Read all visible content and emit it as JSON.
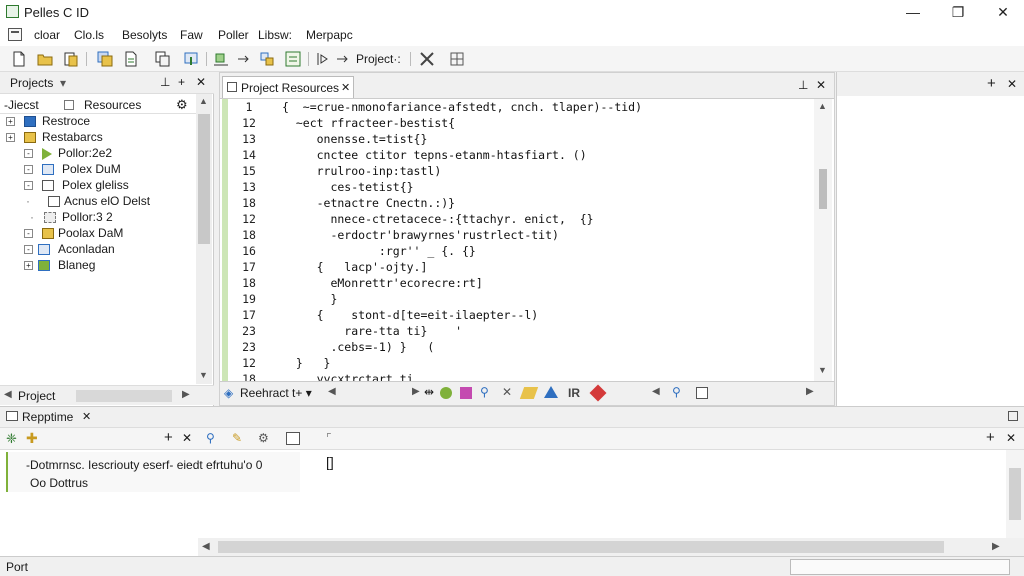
{
  "window": {
    "title": "Pelles C ID",
    "minimize": "—",
    "maximize": "❐",
    "close": "✕"
  },
  "menu": [
    "cloar",
    "Clo.ls",
    "Besolyts",
    "Faw",
    "Poller",
    "Libsw:",
    "Merpapc"
  ],
  "toolbar": {
    "project_label": "Project·:"
  },
  "projects_panel": {
    "title": "Projects",
    "dropdown": "▾",
    "pin": "⊥",
    "close": "✕",
    "subtabs": {
      "files": "-Jiecst",
      "resources": "Resources"
    },
    "tree": [
      {
        "label": "Restroce",
        "indent": 0,
        "expander": "+",
        "icon": "folder-blue"
      },
      {
        "label": "Restabarcs",
        "indent": 0,
        "expander": "+",
        "icon": "folder-yellow"
      },
      {
        "label": "Pollor:2e2",
        "indent": 1,
        "expander": "-",
        "icon": "play-green"
      },
      {
        "label": "Polex DuM",
        "indent": 1,
        "expander": "-",
        "icon": "file-blue"
      },
      {
        "label": "Polex gleliss",
        "indent": 1,
        "expander": "-",
        "icon": "file-white"
      },
      {
        "label": "Acnus elO Delst",
        "indent": 1,
        "expander": "·",
        "icon": "file-white"
      },
      {
        "label": "Pollor:3 2",
        "indent": 1,
        "expander": "·",
        "icon": "file-grey"
      },
      {
        "label": "Poolax DaM",
        "indent": 1,
        "expander": "-",
        "icon": "folder-yellow"
      },
      {
        "label": "Aconladan",
        "indent": 1,
        "expander": "-",
        "icon": "window-blue"
      },
      {
        "label": "Blaneg",
        "indent": 1,
        "expander": "+",
        "icon": "image-green"
      }
    ],
    "bottom_tab": "Project"
  },
  "editor": {
    "tab_label": "Project Resources",
    "tab_close": "✕",
    "pin": "⊥",
    "close": "✕",
    "line_numbers": [
      "1",
      "12",
      "13",
      "14",
      "15",
      "13",
      "18",
      "12",
      "18",
      "16",
      "17",
      "18",
      "19",
      "17",
      "23",
      "23",
      "12",
      "18"
    ],
    "code_lines": [
      "{  ~=crue-nmonofariance-afstedt, cnch. tlaper)--tid)",
      "  ~ect rfracteer-bestist{",
      "     onensse.t=tist{}",
      "     cnctee ctitor tepns-etanm-htasfiart. ()",
      "     rrulroo-inp:tastl)",
      "       ces-tetist{}",
      "     -etnactre Cnectn.:)}",
      "       nnece-ctretacece-:{ttachyr. enict,  {}",
      "       -erdoctr'brawyrnes'rustrlect-tit)",
      "              :rgr'' _ {. {}",
      "     {   lacp'-ojty.]",
      "       eMonrettr'ecorecre:rt]",
      "       }",
      "     {    stont-d[te=eit-ilaepter--l)",
      "         rare-tta ti}    '",
      "       .cebs=-1) }   (",
      "  }   }",
      "     yycxtrctart ti"
    ],
    "bottom_tab": "Reehract t+ ▾",
    "bottom_ir": "IR"
  },
  "right_panel": {
    "plus": "+",
    "close": "✕"
  },
  "output_panel": {
    "title": "Repptime",
    "title_close": "✕",
    "plus": "+",
    "close": "✕",
    "line1": "-Dotmrnsc. Iescriouty eserf- eiedt efrtuhu'o  0",
    "line2": "Oo Dottrus",
    "bracket": "[]"
  },
  "status": {
    "text": "Port"
  },
  "colors": {
    "accent_green": "#2f7a2f",
    "gutter_green": "#cde6b6",
    "folder_yellow": "#e8c24a",
    "icon_blue": "#2f6fc0"
  }
}
